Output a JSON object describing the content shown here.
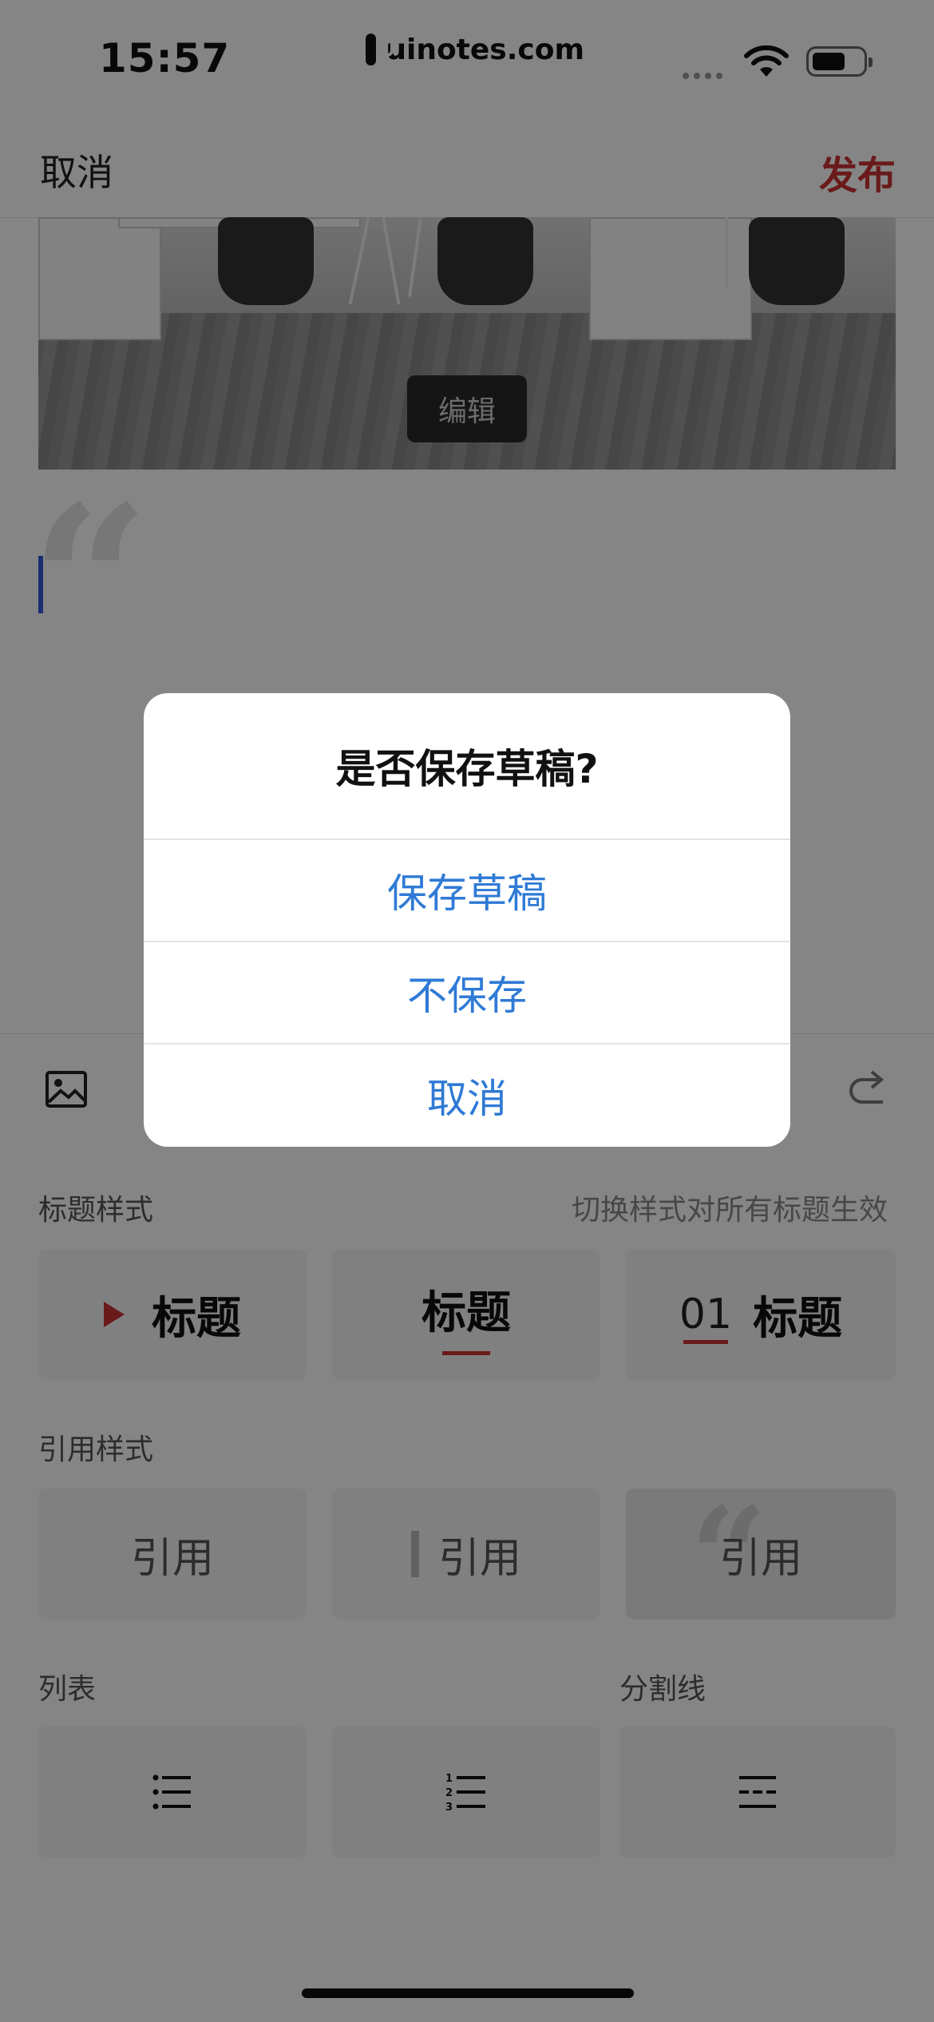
{
  "status_bar": {
    "time": "15:57",
    "url": "uinotes.com"
  },
  "nav": {
    "cancel": "取消",
    "publish": "发布"
  },
  "editor": {
    "edit_badge": "编辑",
    "quote_mark": "“"
  },
  "toolbar": {
    "title_style_label": "标题样式",
    "title_style_hint": "切换样式对所有标题生效",
    "title_options": [
      "标题",
      "标题",
      "标题"
    ],
    "title_number_prefix": "01",
    "quote_style_label": "引用样式",
    "quote_options": [
      "引用",
      "引用",
      "引用"
    ],
    "list_label": "列表",
    "divider_label": "分割线"
  },
  "dialog": {
    "title": "是否保存草稿?",
    "buttons": [
      "保存草稿",
      "不保存",
      "取消"
    ],
    "accent_color": "#2f7ad6"
  },
  "colors": {
    "brand_red": "#cc3333",
    "caret_blue": "#2e5bd6"
  }
}
